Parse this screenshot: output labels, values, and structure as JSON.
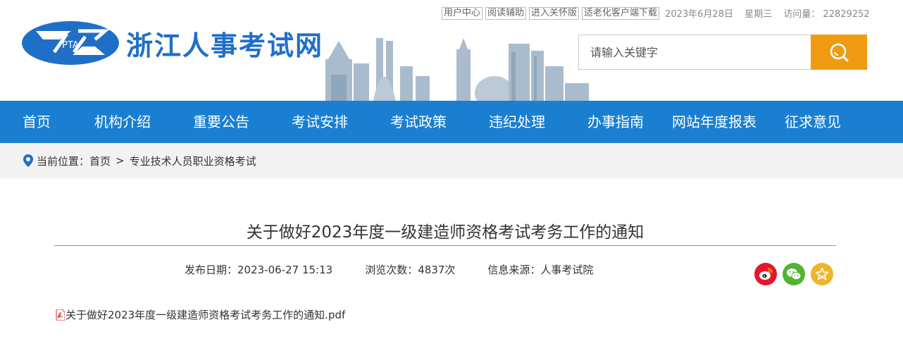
{
  "site": {
    "logo_abbr": "PTA",
    "name": "浙江人事考试网"
  },
  "toplinks": [
    "用户中心",
    "阅读辅助",
    "进入关怀版",
    "适老化客户端下载"
  ],
  "header_info": {
    "date": "2023年6月28日",
    "weekday": "星期三",
    "visits_label": "访问量：",
    "visits": "22829252"
  },
  "search": {
    "placeholder": "请输入关键字"
  },
  "nav": [
    "首页",
    "机构介绍",
    "重要公告",
    "考试安排",
    "考试政策",
    "违纪处理",
    "办事指南",
    "网站年度报表",
    "征求意见"
  ],
  "breadcrumb": {
    "label": "当前位置：",
    "home": "首页",
    "separator": ">",
    "current": "专业技术人员职业资格考试"
  },
  "article": {
    "title": "关于做好2023年度一级建造师资格考试考务工作的通知",
    "publish_label": "发布日期：",
    "publish_date": "2023-06-27 15:13",
    "views_label": "浏览次数：",
    "views": "4837次",
    "source_label": "信息来源：",
    "source": "人事考试院",
    "attachment": "关于做好2023年度一级建造师资格考试考务工作的通知.pdf"
  },
  "share_icons": [
    "weibo-icon",
    "wechat-icon",
    "favorite-star-icon"
  ],
  "colors": {
    "brand_blue": "#1f6fc8",
    "nav_blue": "#1a7fd0",
    "search_orange": "#ef9a10",
    "weibo_red": "#e6162d",
    "wechat_green": "#51b332",
    "star_yellow": "#f0b429"
  }
}
